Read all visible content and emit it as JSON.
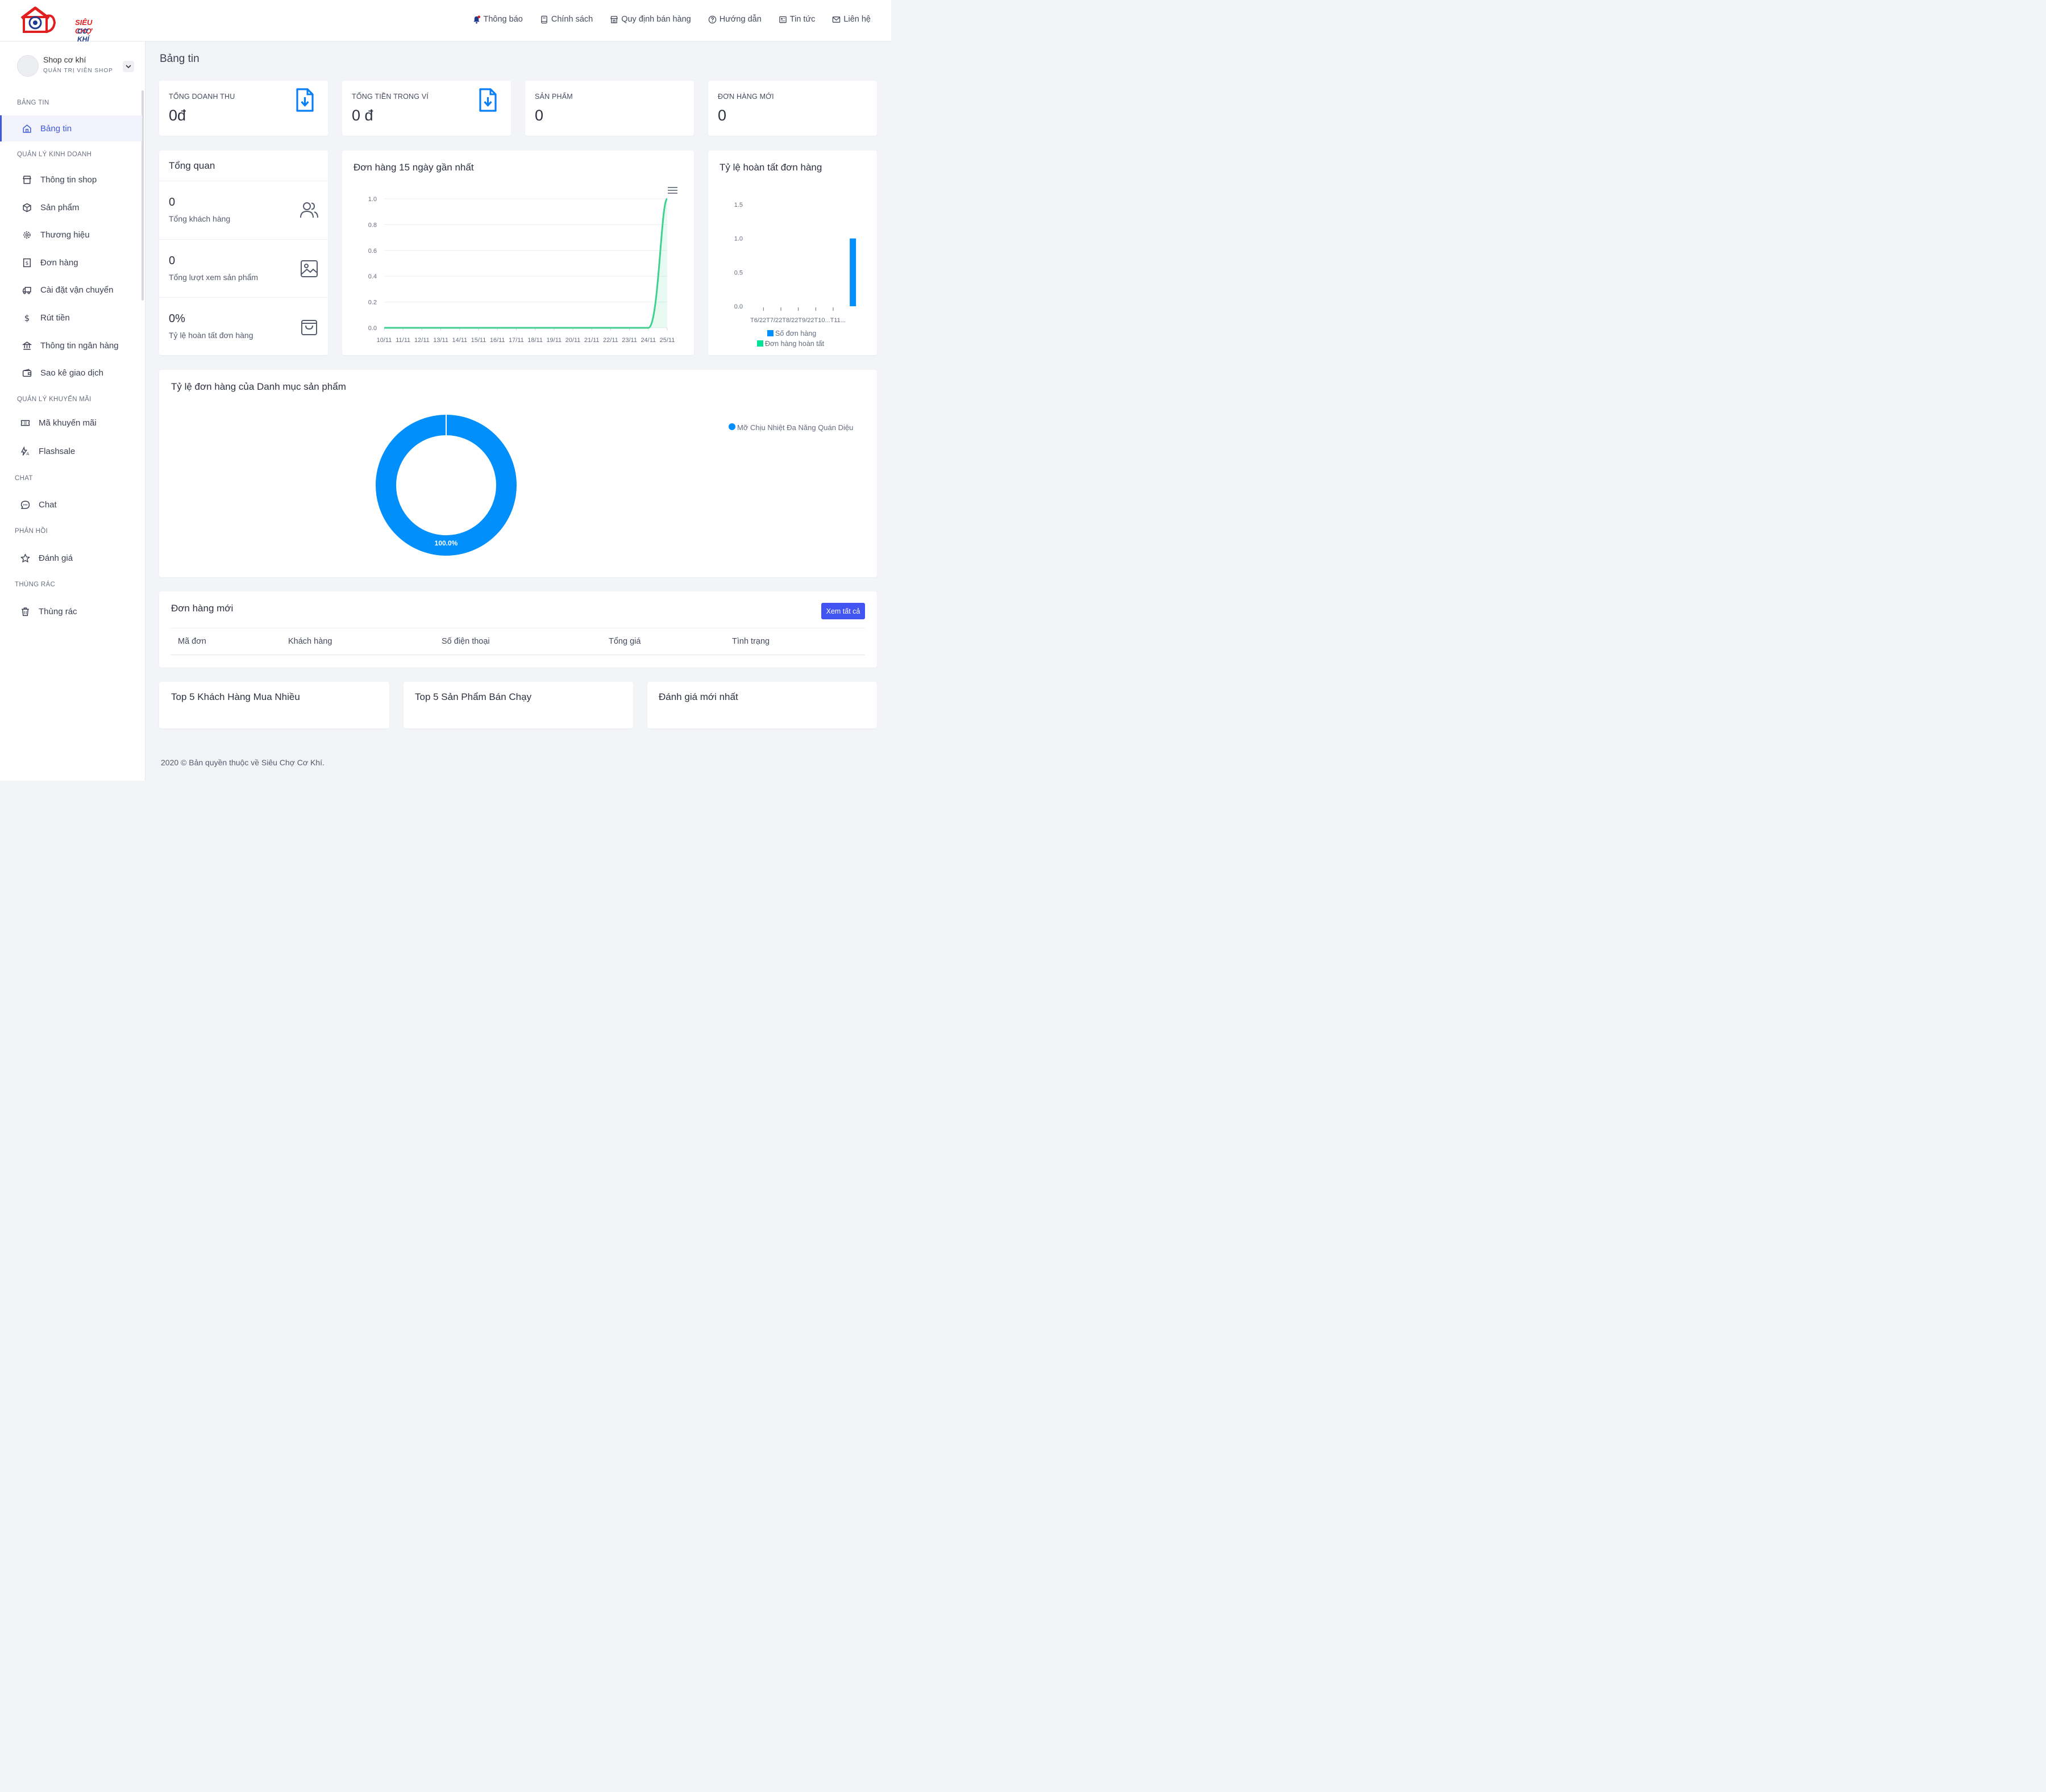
{
  "brand": {
    "line1": "SIÊU CHỢ",
    "line2": "CƠ KHÍ"
  },
  "topnav": [
    {
      "label": "Thông báo",
      "icon": "bell-icon"
    },
    {
      "label": "Chính sách",
      "icon": "book-icon"
    },
    {
      "label": "Quy định bán hàng",
      "icon": "store-icon"
    },
    {
      "label": "Hướng dẫn",
      "icon": "help-circle-icon"
    },
    {
      "label": "Tin tức",
      "icon": "news-icon"
    },
    {
      "label": "Liên hệ",
      "icon": "mail-icon"
    }
  ],
  "user": {
    "name": "Shop cơ khí",
    "role": "QUẢN TRỊ VIÊN SHOP"
  },
  "sidebar": {
    "sections": [
      "BẢNG TIN",
      "QUẢN LÝ KINH DOANH",
      "QUẢN LÝ KHUYẾN MÃI",
      "CHAT",
      "PHẢN HỒI",
      "THÙNG RÁC"
    ],
    "items": [
      "Bảng tin",
      "Thông tin shop",
      "Sản phẩm",
      "Thương hiệu",
      "Đơn hàng",
      "Cài đặt vận chuyển",
      "Rút tiền",
      "Thông tin ngân hàng",
      "Sao kê giao dịch",
      "Mã khuyến mãi",
      "Flashsale",
      "Chat",
      "Đánh giá",
      "Thùng rác"
    ]
  },
  "page_title": "Bảng tin",
  "stats": [
    {
      "label": "TỔNG DOANH THU",
      "value": "0đ"
    },
    {
      "label": "TỔNG TIỀN TRONG VÍ",
      "value": "0 đ"
    },
    {
      "label": "SẢN PHẨM",
      "value": "0"
    },
    {
      "label": "ĐƠN HÀNG MỚI",
      "value": "0"
    }
  ],
  "overview": {
    "title": "Tổng quan",
    "rows": [
      {
        "value": "0",
        "label": "Tổng khách hàng"
      },
      {
        "value": "0",
        "label": "Tổng lượt xem sản phẩm"
      },
      {
        "value": "0%",
        "label": "Tỷ lệ hoàn tất đơn hàng"
      }
    ]
  },
  "colors": {
    "accent": "#3d5bd9",
    "button": "#4154f1",
    "blue": "#008ffb",
    "green": "#3fd190"
  },
  "chart_data": [
    {
      "type": "area",
      "title": "Đơn hàng 15 ngày gần nhất",
      "x": [
        "10/11",
        "11/11",
        "12/11",
        "13/11",
        "14/11",
        "15/11",
        "16/11",
        "17/11",
        "18/11",
        "19/11",
        "20/11",
        "21/11",
        "22/11",
        "23/11",
        "24/11",
        "25/11"
      ],
      "values": [
        0,
        0,
        0,
        0,
        0,
        0,
        0,
        0,
        0,
        0,
        0,
        0,
        0,
        0,
        0,
        1
      ],
      "yticks": [
        "0.0",
        "0.2",
        "0.4",
        "0.6",
        "0.8",
        "1.0"
      ],
      "ylim": [
        0,
        1
      ]
    },
    {
      "type": "bar",
      "title": "Tỷ lệ hoàn tất đơn hàng",
      "categories": [
        "T6/22",
        "T7/22",
        "T8/22",
        "T9/22",
        "T10...",
        "T11..."
      ],
      "series": [
        {
          "name": "Số đơn hàng",
          "values": [
            0,
            0,
            0,
            0,
            0,
            1
          ]
        },
        {
          "name": "Đơn hàng hoàn tất",
          "values": [
            0,
            0,
            0,
            0,
            0,
            0
          ]
        }
      ],
      "xtick_text": "T6/22T7/22T8/22T9/22T10...T11...",
      "yticks": [
        "0.0",
        "0.5",
        "1.0",
        "1.5"
      ],
      "ylim": [
        0,
        1.5
      ]
    },
    {
      "type": "pie",
      "title": "Tỷ lệ đơn hàng của Danh mục sản phẩm",
      "labels": [
        "Mỡ Chịu Nhiệt Đa Năng Quán Diệu"
      ],
      "values": [
        100
      ],
      "data_label": "100.0%"
    }
  ],
  "orders": {
    "title": "Đơn hàng mới",
    "button": "Xem tất cả",
    "columns": [
      "Mã đơn",
      "Khách hàng",
      "Số điện thoại",
      "Tổng giá",
      "Tình trạng"
    ]
  },
  "bottom_cards": [
    "Top 5 Khách Hàng Mua Nhiều",
    "Top 5 Sản Phẩm Bán Chạy",
    "Đánh giá mới nhất"
  ],
  "footer": "2020 © Bản quyền thuộc về Siêu Chợ Cơ Khí."
}
